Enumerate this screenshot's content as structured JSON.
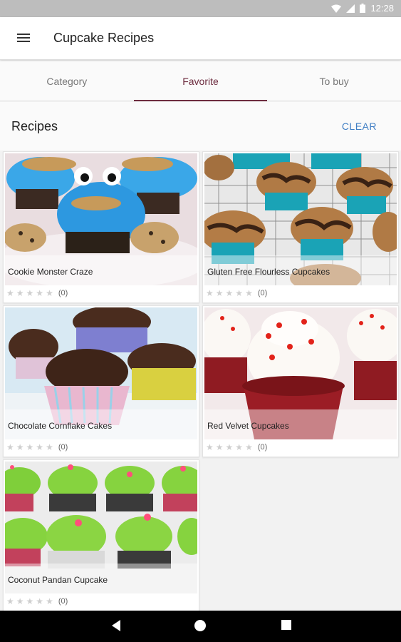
{
  "status_bar": {
    "time": "12:28"
  },
  "app_bar": {
    "title": "Cupcake Recipes"
  },
  "tabs": [
    {
      "label": "Category"
    },
    {
      "label": "Favorite"
    },
    {
      "label": "To buy"
    }
  ],
  "section": {
    "title": "Recipes",
    "clear_label": "CLEAR"
  },
  "recipes": [
    {
      "name": "Cookie Monster Craze",
      "count": "(0)"
    },
    {
      "name": "Gluten Free Flourless Cupcakes",
      "count": "(0)"
    },
    {
      "name": "Chocolate Cornflake Cakes",
      "count": "(0)"
    },
    {
      "name": "Red Velvet Cupcakes",
      "count": "(0)"
    },
    {
      "name": "Coconut Pandan Cupcake",
      "count": "(0)"
    }
  ],
  "colors": {
    "accent": "#6d2c3f",
    "link": "#3f7ec4"
  },
  "icons": [
    "menu-icon",
    "wifi-icon",
    "signal-icon",
    "battery-icon",
    "star-icon",
    "back-icon",
    "home-icon",
    "recents-icon"
  ]
}
